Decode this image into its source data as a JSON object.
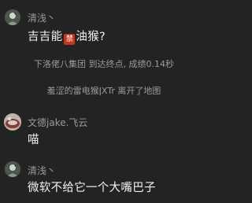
{
  "colors": {
    "background": "#232323",
    "username": "#9a9a9a",
    "message_text": "#f2f2f2",
    "system_text": "#9b9b9b",
    "ban_emoji": "#c8341f"
  },
  "messages": [
    {
      "avatar_icon": "user-avatar-icon",
      "username": "清浅丶",
      "text_before": "吉吉能",
      "emoji_label": "禁",
      "text_after": "油猴?"
    },
    {
      "avatar_icon": "user-avatar-icon",
      "username": "文德jake.飞云",
      "text": "喵"
    },
    {
      "avatar_icon": "user-avatar-icon",
      "username": "清浅丶",
      "text": "微软不给它一个大嘴巴子"
    }
  ],
  "system_messages": [
    "下洛佬八集团 到达终点, 成绩0.14秒",
    "羞涩的雷电猴ǀXTr 离开了地图"
  ]
}
